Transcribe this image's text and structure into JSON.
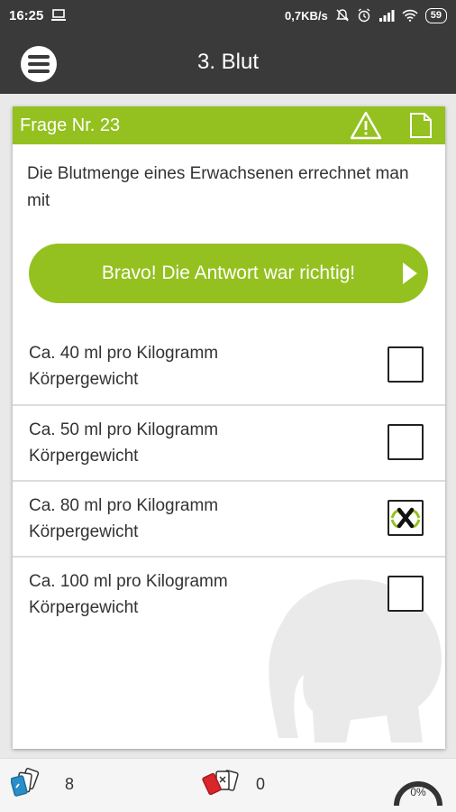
{
  "status_bar": {
    "time": "16:25",
    "network_speed": "0,7KB/s",
    "battery": "59"
  },
  "app_bar": {
    "title": "3. Blut",
    "menu_icon": "hamburger-icon"
  },
  "question_card": {
    "number_label": "Frage Nr. 23",
    "warning_icon": "warning-triangle-icon",
    "note_icon": "document-icon",
    "question": "Die Blutmenge eines Erwachsenen errechnet man mit",
    "feedback": "Bravo! Die Antwort war richtig!",
    "answers": [
      {
        "text": "Ca. 40 ml pro Kilogramm Körpergewicht",
        "checked": false
      },
      {
        "text": "Ca. 50 ml pro Kilogramm Körpergewicht",
        "checked": false
      },
      {
        "text": "Ca. 80 ml pro Kilogramm Körpergewicht",
        "checked": true
      },
      {
        "text": "Ca. 100 ml pro Kilogramm Körpergewicht",
        "checked": false
      }
    ]
  },
  "bottom_bar": {
    "learned_count": "8",
    "wrong_count": "0",
    "progress": "0%"
  },
  "colors": {
    "accent": "#94c11f",
    "dark": "#3a3a3a",
    "wrong_card": "#d9262b",
    "learned_card": "#2a8fc9"
  }
}
